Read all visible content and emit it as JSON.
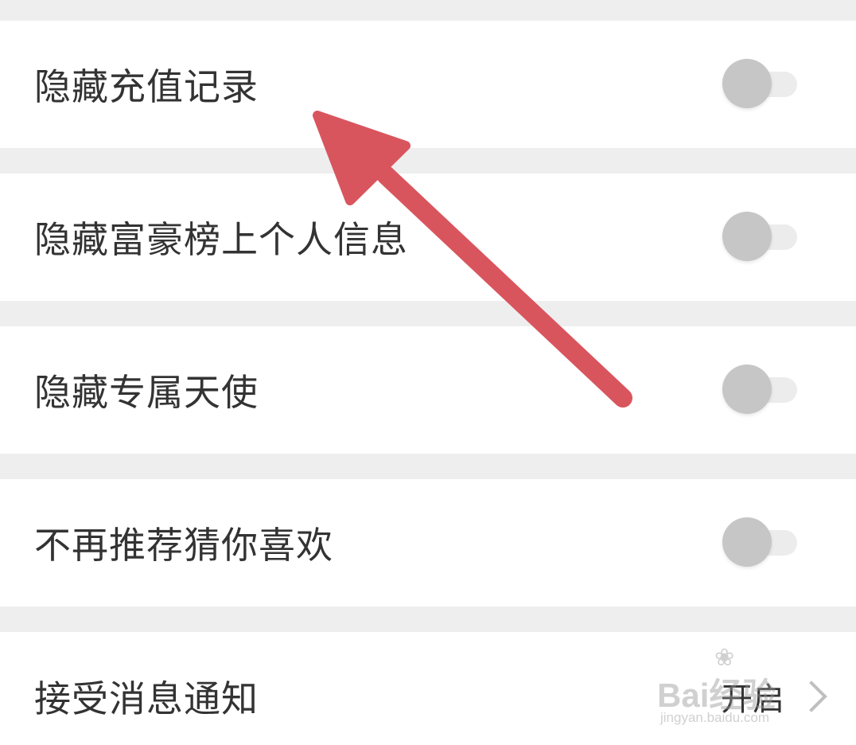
{
  "settings": {
    "items": [
      {
        "label": "隐藏充值记录",
        "toggle_on": false
      },
      {
        "label": "隐藏富豪榜上个人信息",
        "toggle_on": false
      },
      {
        "label": "隐藏专属天使",
        "toggle_on": false
      },
      {
        "label": "不再推荐猜你喜欢",
        "toggle_on": false
      }
    ],
    "notification": {
      "label": "接受消息通知",
      "value": "开启"
    }
  },
  "annotation": {
    "arrow_color": "#d9555e",
    "arrow_icon": "red-arrow-annotation"
  },
  "watermark": {
    "icon": "baidu-paw-icon",
    "brand": "Bai",
    "brand_cn": "经验",
    "site": "jingyan.baidu.com"
  },
  "colors": {
    "background": "#eeeeee",
    "row": "#ffffff",
    "text": "#333333",
    "toggle_knob": "#c6c6c6",
    "toggle_track": "#ececec"
  }
}
